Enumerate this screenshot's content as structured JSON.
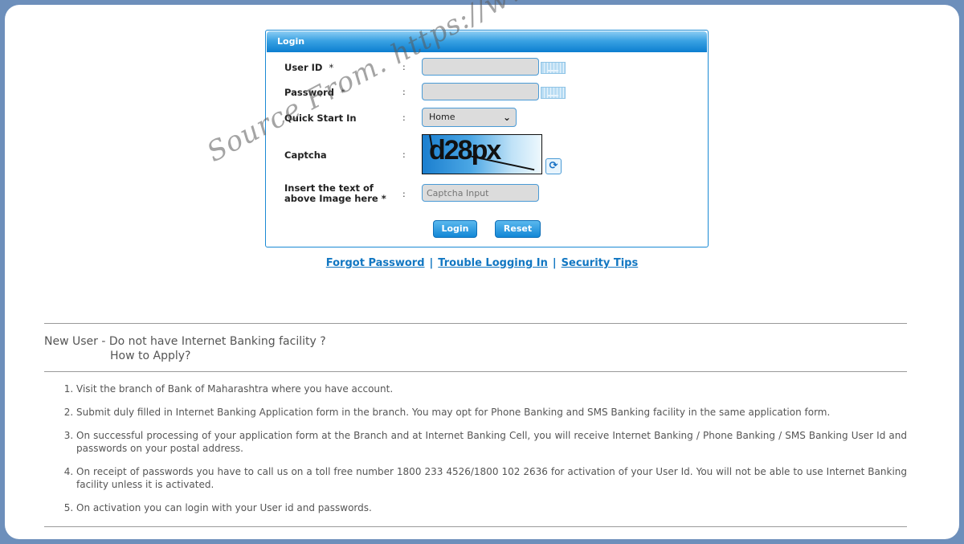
{
  "login": {
    "title": "Login",
    "fields": {
      "user_id": {
        "label": "User ID",
        "required_mark": "*",
        "value": "",
        "placeholder": ""
      },
      "password": {
        "label": "Password",
        "required_mark": "*",
        "value": "",
        "placeholder": ""
      },
      "quick_start": {
        "label": "Quick Start In",
        "selected": "Home"
      },
      "captcha": {
        "label": "Captcha",
        "image_text": "d28px"
      },
      "captcha_input": {
        "label_line1": "Insert the text of",
        "label_line2": "above Image here *",
        "value": "",
        "placeholder": "Captcha Input"
      }
    },
    "colon": ":",
    "buttons": {
      "login": "Login",
      "reset": "Reset"
    }
  },
  "links": {
    "forgot_password": "Forgot Password",
    "trouble_logging_in": "Trouble Logging In",
    "security_tips": "Security Tips",
    "separator": "|"
  },
  "new_user": {
    "heading_line1": "New User - Do not have Internet Banking facility ?",
    "heading_line2": "How to Apply?",
    "steps": [
      "Visit the branch of Bank of Maharashtra where you have account.",
      "Submit duly filled in Internet Banking Application form in the branch. You may opt for Phone Banking and SMS Banking facility in the same application form.",
      "On successful processing of your application form at the Branch and at Internet Banking Cell, you will receive Internet Banking / Phone Banking / SMS Banking User Id and passwords on your postal address.",
      "On receipt of passwords you have to call us on a toll free number 1800 233 4526/1800 102 2636 for activation of your User Id. You will not be able to use Internet Banking facility unless it is activated.",
      "On activation you can login with your User id and passwords."
    ]
  },
  "watermark": "Source From. https://www.mahaconnect.in/",
  "colors": {
    "accent": "#1287d6",
    "link": "#1277c2",
    "frame": "#6d8fbb"
  }
}
